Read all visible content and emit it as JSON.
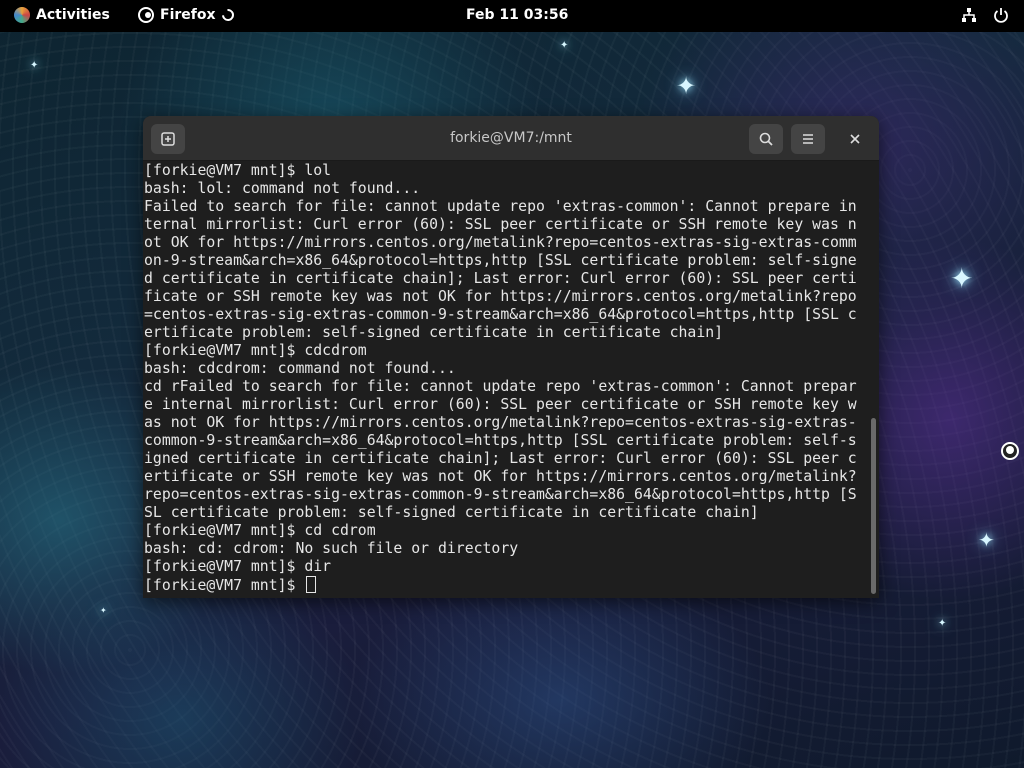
{
  "topbar": {
    "activities": "Activities",
    "app_name": "Firefox",
    "clock": "Feb 11  03:56",
    "icons": [
      "network-icon",
      "power-icon"
    ]
  },
  "terminal": {
    "title": "forkie@VM7:/mnt",
    "lines": [
      "[forkie@VM7 mnt]$ lol",
      "bash: lol: command not found...",
      "Failed to search for file: cannot update repo 'extras-common': Cannot prepare in",
      "ternal mirrorlist: Curl error (60): SSL peer certificate or SSH remote key was n",
      "ot OK for https://mirrors.centos.org/metalink?repo=centos-extras-sig-extras-comm",
      "on-9-stream&arch=x86_64&protocol=https,http [SSL certificate problem: self-signe",
      "d certificate in certificate chain]; Last error: Curl error (60): SSL peer certi",
      "ficate or SSH remote key was not OK for https://mirrors.centos.org/metalink?repo",
      "=centos-extras-sig-extras-common-9-stream&arch=x86_64&protocol=https,http [SSL c",
      "ertificate problem: self-signed certificate in certificate chain]",
      "[forkie@VM7 mnt]$ cdcdrom",
      "bash: cdcdrom: command not found...",
      "cd rFailed to search for file: cannot update repo 'extras-common': Cannot prepar",
      "e internal mirrorlist: Curl error (60): SSL peer certificate or SSH remote key w",
      "as not OK for https://mirrors.centos.org/metalink?repo=centos-extras-sig-extras-",
      "common-9-stream&arch=x86_64&protocol=https,http [SSL certificate problem: self-s",
      "igned certificate in certificate chain]; Last error: Curl error (60): SSL peer c",
      "ertificate or SSH remote key was not OK for https://mirrors.centos.org/metalink?",
      "repo=centos-extras-sig-extras-common-9-stream&arch=x86_64&protocol=https,http [S",
      "SL certificate problem: self-signed certificate in certificate chain]",
      "[forkie@VM7 mnt]$ cd cdrom",
      "bash: cd: cdrom: No such file or directory",
      "[forkie@VM7 mnt]$ dir"
    ],
    "prompt": "[forkie@VM7 mnt]$ "
  }
}
